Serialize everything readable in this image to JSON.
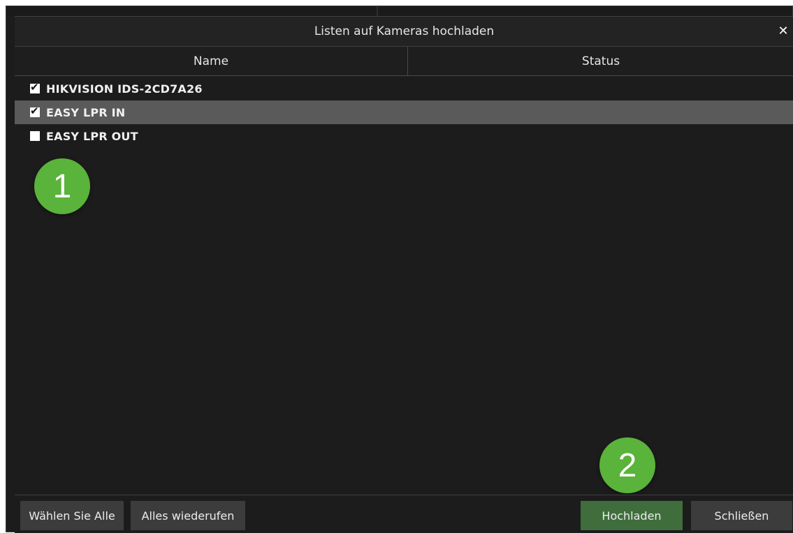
{
  "dialog": {
    "title": "Listen auf Kameras hochladen",
    "close_glyph": "✕"
  },
  "columns": {
    "name": "Name",
    "status": "Status"
  },
  "cameras": [
    {
      "name": "HIKVISION IDS-2CD7A26",
      "checked": true,
      "selected": false,
      "status": ""
    },
    {
      "name": "EASY LPR IN",
      "checked": true,
      "selected": true,
      "status": ""
    },
    {
      "name": "EASY LPR OUT",
      "checked": false,
      "selected": false,
      "status": ""
    }
  ],
  "annotations": {
    "badge_1": "1",
    "badge_2": "2"
  },
  "buttons": {
    "select_all": "Wählen Sie Alle",
    "revoke_all": "Alles wiederufen",
    "upload": "Hochladen",
    "close": "Schließen"
  },
  "colors": {
    "background": "#1c1c1c",
    "selected_row": "#5a5a5a",
    "badge": "#5ab33a",
    "primary_button": "#3f6e3c"
  }
}
